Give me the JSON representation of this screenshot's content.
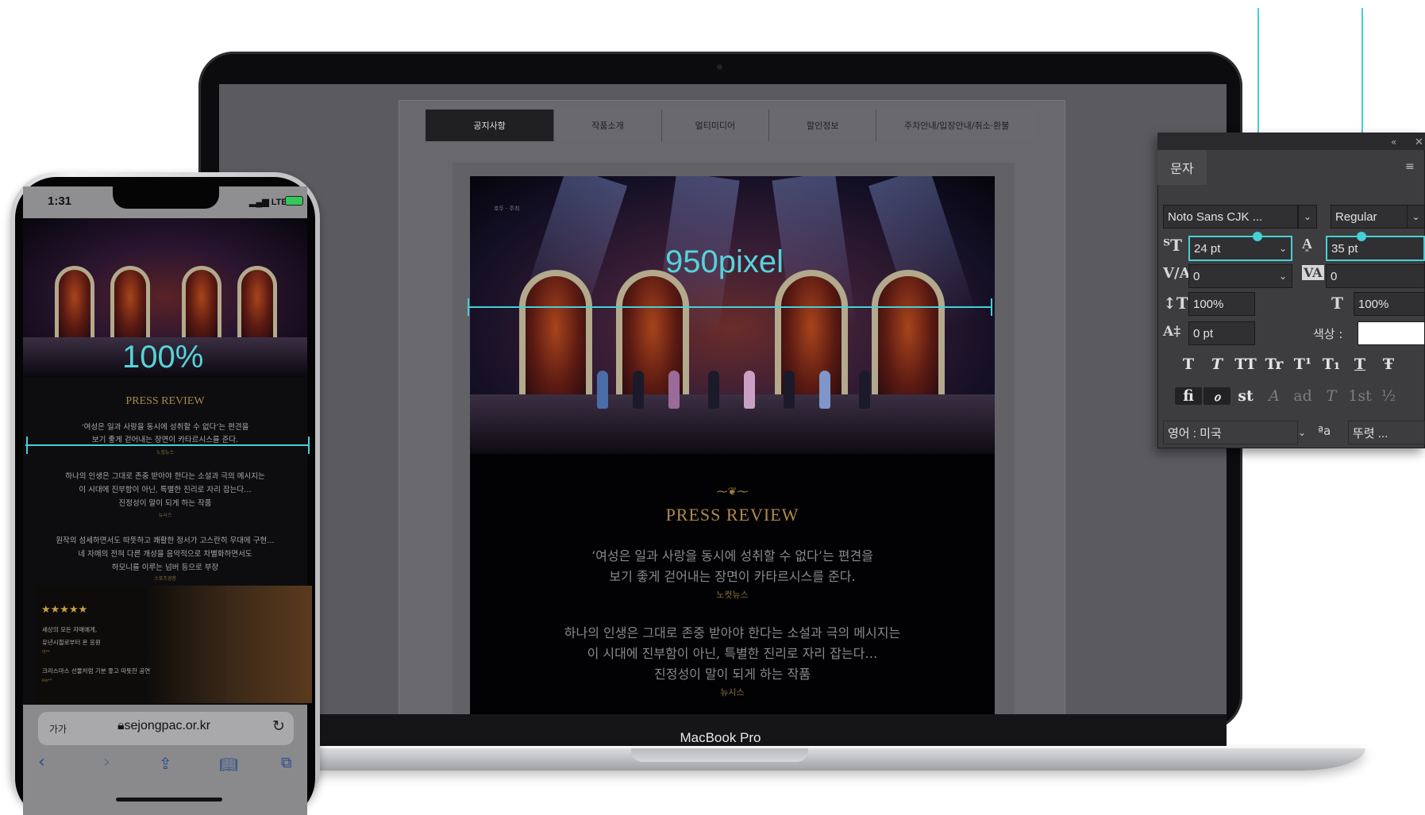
{
  "macbook": {
    "model_label": "MacBook Pro",
    "nav": [
      "공지사항",
      "작품소개",
      "멀티미디어",
      "할인정보",
      "주차안내/입장안내/취소·환불"
    ],
    "poster_corner_text": "호두 · 주최",
    "press_title": "PRESS REVIEW",
    "reviews": [
      {
        "lines": [
          "‘여성은 일과 사랑을 동시에 성취할 수 없다’는 편견을",
          "보기 좋게 걷어내는 장면이 카타르시스를 준다."
        ],
        "source": "노컷뉴스"
      },
      {
        "lines": [
          "하나의 인생은 그대로 존중 받아야 한다는 소설과 극의 메시지는",
          "이 시대에 진부함이 아닌, 특별한 진리로 자리 잡는다…",
          "진정성이 말이 되게 하는 작품"
        ],
        "source": "뉴시스"
      }
    ],
    "measure_label": "950pixel"
  },
  "photoshop": {
    "tab_label": "문자",
    "font_family": "Noto Sans CJK ...",
    "font_style": "Regular",
    "font_size": "24 pt",
    "leading": "35 pt",
    "kerning": "0",
    "tracking": "0",
    "vertical_scale": "100%",
    "horizontal_scale": "100%",
    "baseline_shift": "0 pt",
    "color_label": "색상 :",
    "color_value": "#ffffff",
    "language": "영어 : 미국",
    "antialias_icon": "ªa",
    "antialias": "뚜렷 ...",
    "style_buttons": [
      "T",
      "T",
      "TT",
      "Tr",
      "T¹",
      "T₁",
      "T",
      "Ŧ"
    ],
    "opentype_buttons": [
      "fi",
      "ℴ",
      "st",
      "A",
      "ad",
      "T",
      "1st",
      "½"
    ],
    "highlight_color": "#46cfd6"
  },
  "iphone": {
    "time": "1:31",
    "network": "LTE",
    "measure_label": "100%",
    "press_title": "PRESS REVIEW",
    "reviews": [
      {
        "lines": [
          "‘여성은 일과 사랑을 동시에 성취할 수 없다’는 편견을",
          "보기 좋게 걷어내는 장면이 카타르시스를 준다."
        ],
        "source": "노컷뉴스"
      },
      {
        "lines": [
          "하나의 인생은 그대로 존중 받아야 한다는 소설과 극의 메시지는",
          "이 시대에 진부함이 아닌, 특별한 진리로 자리 잡는다…",
          "진정성이 말이 되게 하는 작품"
        ],
        "source": "뉴시스"
      },
      {
        "lines": [
          "원작의 섬세하면서도 따뜻하고 쾌활한 정서가 고스란히 무대에 구현…",
          "네 자매의 전혀 다른 개성을 음악적으로 차별화하면서도",
          "하모니를 이루는 넘버 등으로 부장"
        ],
        "source": "스포츠경향"
      }
    ],
    "stars": "★★★★★",
    "card_lines": [
      "세상의 모든 자매에게,",
      "유년시절로부터 온 응원",
      "이**",
      "크리스마스 선물처럼 기분 좋고 따뜻한 공연",
      "kie**"
    ],
    "text_size_btn": "가가",
    "url": "sejongpac.or.kr",
    "toolbar": [
      "back-icon",
      "forward-icon",
      "share-icon",
      "bookmarks-icon",
      "tabs-icon"
    ]
  }
}
